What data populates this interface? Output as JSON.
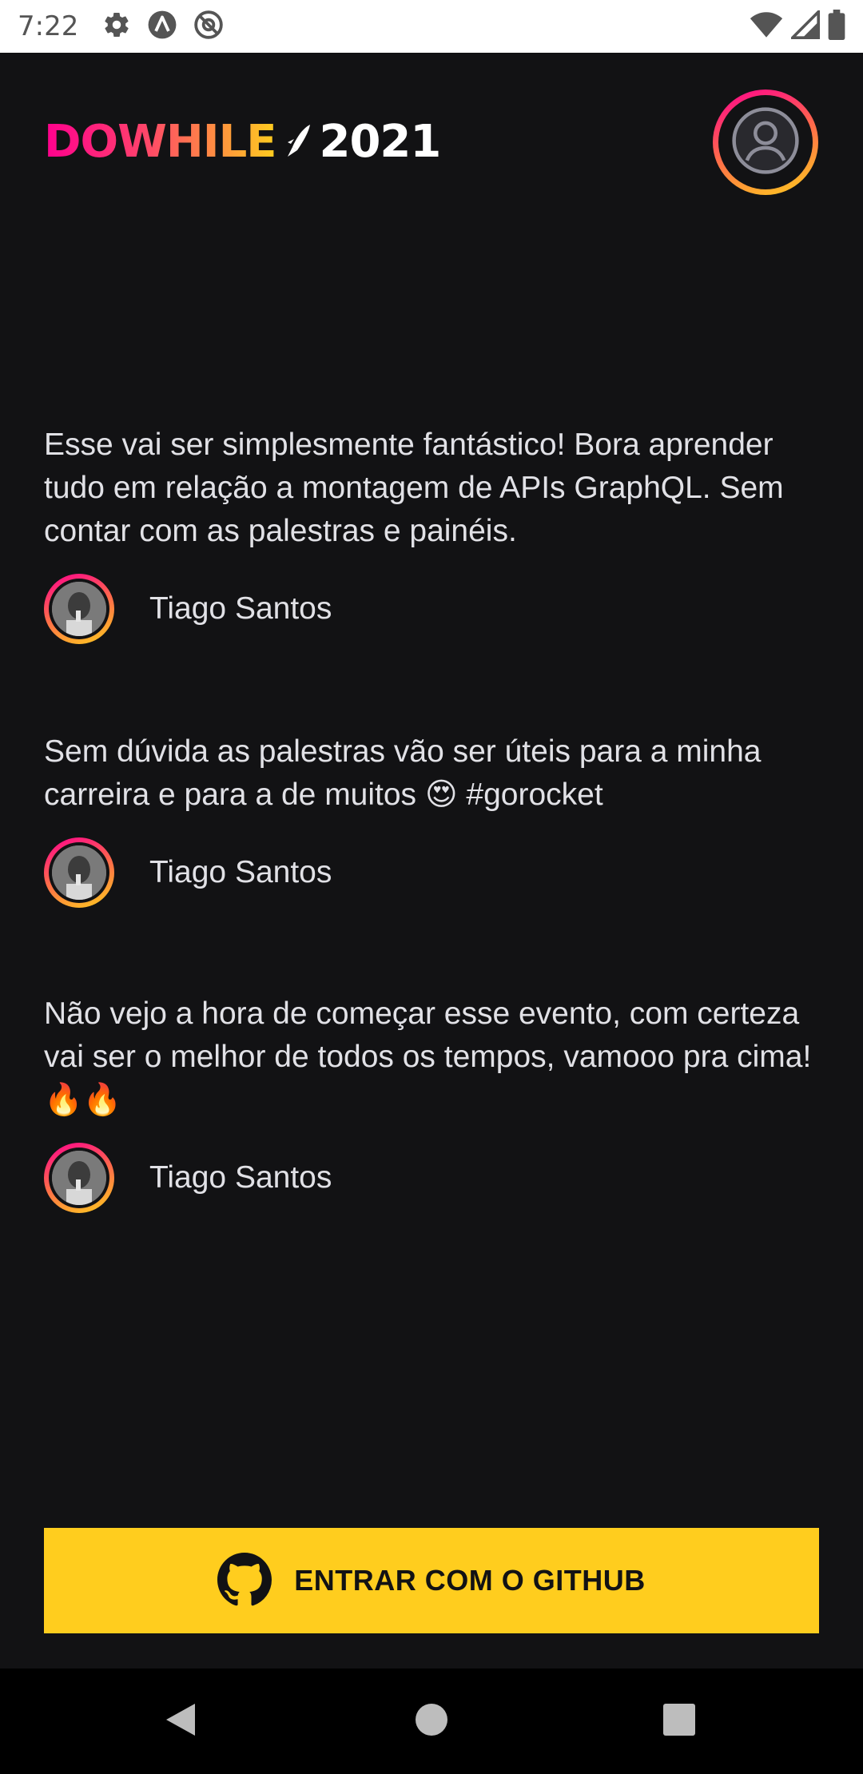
{
  "status_bar": {
    "time": "7:22",
    "left_icons": [
      "settings-icon",
      "app-a-icon",
      "at-sign-icon"
    ],
    "right_icons": [
      "wifi-icon",
      "signal-icon",
      "battery-icon"
    ]
  },
  "header": {
    "logo_text": "DOWHILE",
    "logo_year": "2021",
    "profile_icon": "user-circle-icon"
  },
  "messages": [
    {
      "text": "Esse vai ser simplesmente fantástico! Bora aprender tudo em relação a montagem de APIs GraphQL. Sem contar com as palestras e painéis.",
      "author": "Tiago Santos"
    },
    {
      "text": "Sem dúvida as palestras vão ser úteis para a minha carreira e para a de muitos 😍 #gorocket",
      "author": "Tiago Santos"
    },
    {
      "text": "Não vejo a hora de começar esse evento, com certeza vai ser o melhor de todos os tempos, vamooo pra cima! 🔥🔥",
      "author": "Tiago Santos"
    }
  ],
  "login_button": {
    "label": "ENTRAR COM O GITHUB",
    "icon": "github-icon"
  },
  "nav_bar": {
    "buttons": [
      "back-icon",
      "home-icon",
      "recents-icon"
    ]
  },
  "colors": {
    "background": "#121214",
    "text": "#e1e1e6",
    "button": "#ffcd1e",
    "gradient_start": "#ff008e",
    "gradient_end": "#ffcd1e"
  }
}
